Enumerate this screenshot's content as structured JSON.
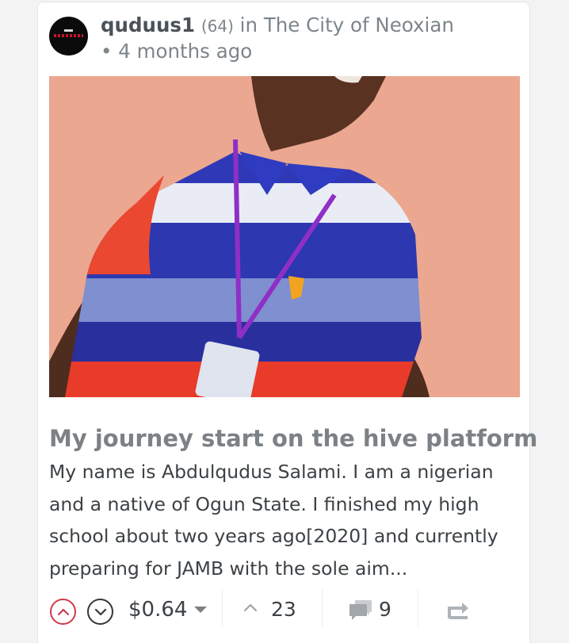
{
  "post": {
    "author": "quduus1",
    "reputation": "(64)",
    "community_prefix": " in ",
    "community": "The City of Neoxian",
    "separator": " • ",
    "age": "4 months ago",
    "title": "My journey start on the hive platform",
    "summary": "My name is Abdulqudus Salami. I am a nigerian and a native of Ogun State. I finished my high school about two years ago[2020] and currently preparing for JAMB with the sole aim...",
    "payout": "$0.64",
    "votes": "23",
    "comments": "9"
  },
  "icons": {
    "upvote": "chevron-up-circle-icon",
    "downvote": "chevron-down-circle-icon",
    "payout_dropdown": "caret-down-icon",
    "votes": "chevron-up-icon",
    "comments": "chat-bubbles-icon",
    "reblog": "reblog-arrow-icon"
  },
  "colors": {
    "upvote_accent": "#d0394a",
    "title": "#7b8185",
    "text": "#3c4145",
    "meta": "#7d858a"
  }
}
